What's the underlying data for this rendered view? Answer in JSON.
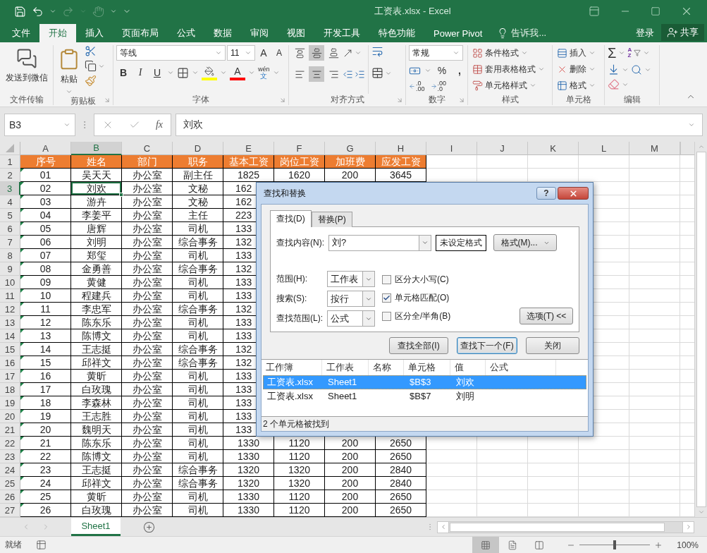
{
  "title_bar": {
    "title": "工资表.xlsx - Excel"
  },
  "menu_tabs": [
    {
      "label": "文件",
      "selected": false
    },
    {
      "label": "开始",
      "selected": true
    },
    {
      "label": "插入",
      "selected": false
    },
    {
      "label": "页面布局",
      "selected": false
    },
    {
      "label": "公式",
      "selected": false
    },
    {
      "label": "数据",
      "selected": false
    },
    {
      "label": "审阅",
      "selected": false
    },
    {
      "label": "视图",
      "selected": false
    },
    {
      "label": "开发工具",
      "selected": false
    },
    {
      "label": "特色功能",
      "selected": false
    },
    {
      "label": "Power Pivot",
      "selected": false
    }
  ],
  "tell_me": {
    "placeholder": "告诉我..."
  },
  "account": {
    "sign_in": "登录",
    "share": "共享"
  },
  "ribbon": {
    "file_transfer": {
      "button": "发送到微信",
      "label": "文件传输"
    },
    "clipboard": {
      "paste": "粘贴",
      "label": "剪贴板"
    },
    "font": {
      "font_name": "等线",
      "font_size": "11",
      "grow": "A",
      "shrink": "A",
      "bold": "B",
      "italic": "I",
      "underline": "U",
      "font_color": "A",
      "phonetic": [
        "wén",
        "文"
      ],
      "label": "字体"
    },
    "alignment": {
      "vertical": [
        {
          "selected": false
        },
        {
          "selected": true
        },
        {
          "selected": false
        }
      ],
      "horizontal": [
        {
          "selected": false
        },
        {
          "selected": true
        },
        {
          "selected": false
        }
      ],
      "label": "对齐方式"
    },
    "number": {
      "format": "常规",
      "percent": "%",
      "comma": ",",
      "decimals": [
        [
          ".0",
          ".00"
        ],
        [
          ".00",
          ".0"
        ]
      ],
      "label": "数字"
    },
    "styles": {
      "items": [
        "条件格式",
        "套用表格格式",
        "单元格样式"
      ],
      "label": "样式"
    },
    "cells": {
      "items": [
        "插入",
        "删除",
        "格式"
      ],
      "label": "单元格"
    },
    "editing": {
      "autosum": "Σ",
      "sort": [
        "A",
        "Z"
      ],
      "label": "编辑"
    }
  },
  "formula_bar": {
    "name_box": "B3",
    "function": "fx",
    "value": "刘欢"
  },
  "columns": [
    {
      "label": "A",
      "selected": false
    },
    {
      "label": "B",
      "selected": true
    },
    {
      "label": "C",
      "selected": false
    },
    {
      "label": "D",
      "selected": false
    },
    {
      "label": "E",
      "selected": false
    },
    {
      "label": "F",
      "selected": false
    },
    {
      "label": "G",
      "selected": false
    },
    {
      "label": "H",
      "selected": false
    },
    {
      "label": "I",
      "selected": false
    },
    {
      "label": "J",
      "selected": false
    },
    {
      "label": "K",
      "selected": false
    },
    {
      "label": "L",
      "selected": false
    },
    {
      "label": "M",
      "selected": false
    }
  ],
  "rows": [
    {
      "number": "1",
      "kind": "header",
      "selected": false,
      "warning": false,
      "cells": [
        "序号",
        "姓名",
        "部门",
        "职务",
        "基本工资",
        "岗位工资",
        "加班费",
        "应发工资"
      ]
    },
    {
      "number": "2",
      "kind": "data",
      "selected": false,
      "warning": true,
      "cells": [
        "01",
        "吴天天",
        "办公室",
        "副主任",
        "1825",
        "1620",
        "200",
        "3645"
      ]
    },
    {
      "number": "3",
      "kind": "data",
      "selected": true,
      "warning": true,
      "cells": [
        "02",
        "刘欢",
        "办公室",
        "文秘",
        "162"
      ]
    },
    {
      "number": "4",
      "kind": "data",
      "selected": false,
      "warning": true,
      "cells": [
        "03",
        "游卉",
        "办公室",
        "文秘",
        "162"
      ]
    },
    {
      "number": "5",
      "kind": "data",
      "selected": false,
      "warning": true,
      "cells": [
        "04",
        "李姜平",
        "办公室",
        "主任",
        "223"
      ]
    },
    {
      "number": "6",
      "kind": "data",
      "selected": false,
      "warning": true,
      "cells": [
        "05",
        "唐辉",
        "办公室",
        "司机",
        "133"
      ]
    },
    {
      "number": "7",
      "kind": "data",
      "selected": false,
      "warning": true,
      "cells": [
        "06",
        "刘明",
        "办公室",
        "综合事务",
        "132"
      ]
    },
    {
      "number": "8",
      "kind": "data",
      "selected": false,
      "warning": true,
      "cells": [
        "07",
        "郑玺",
        "办公室",
        "司机",
        "133"
      ]
    },
    {
      "number": "9",
      "kind": "data",
      "selected": false,
      "warning": true,
      "cells": [
        "08",
        "金勇善",
        "办公室",
        "综合事务",
        "132"
      ]
    },
    {
      "number": "10",
      "kind": "data",
      "selected": false,
      "warning": true,
      "cells": [
        "09",
        "黄健",
        "办公室",
        "司机",
        "133"
      ]
    },
    {
      "number": "11",
      "kind": "data",
      "selected": false,
      "warning": true,
      "cells": [
        "10",
        "程建兵",
        "办公室",
        "司机",
        "133"
      ]
    },
    {
      "number": "12",
      "kind": "data",
      "selected": false,
      "warning": true,
      "cells": [
        "11",
        "李忠军",
        "办公室",
        "综合事务",
        "132"
      ]
    },
    {
      "number": "13",
      "kind": "data",
      "selected": false,
      "warning": true,
      "cells": [
        "12",
        "陈东乐",
        "办公室",
        "司机",
        "133"
      ]
    },
    {
      "number": "14",
      "kind": "data",
      "selected": false,
      "warning": true,
      "cells": [
        "13",
        "陈博文",
        "办公室",
        "司机",
        "133"
      ]
    },
    {
      "number": "15",
      "kind": "data",
      "selected": false,
      "warning": true,
      "cells": [
        "14",
        "王志挺",
        "办公室",
        "综合事务",
        "132"
      ]
    },
    {
      "number": "16",
      "kind": "data",
      "selected": false,
      "warning": true,
      "cells": [
        "15",
        "邱祥文",
        "办公室",
        "综合事务",
        "132"
      ]
    },
    {
      "number": "17",
      "kind": "data",
      "selected": false,
      "warning": true,
      "cells": [
        "16",
        "黄昕",
        "办公室",
        "司机",
        "133"
      ]
    },
    {
      "number": "18",
      "kind": "data",
      "selected": false,
      "warning": true,
      "cells": [
        "17",
        "白玫瑰",
        "办公室",
        "司机",
        "133"
      ]
    },
    {
      "number": "19",
      "kind": "data",
      "selected": false,
      "warning": true,
      "cells": [
        "18",
        "李森林",
        "办公室",
        "司机",
        "133"
      ]
    },
    {
      "number": "20",
      "kind": "data",
      "selected": false,
      "warning": true,
      "cells": [
        "19",
        "王志胜",
        "办公室",
        "司机",
        "133"
      ]
    },
    {
      "number": "21",
      "kind": "data",
      "selected": false,
      "warning": true,
      "cells": [
        "20",
        "魏明天",
        "办公室",
        "司机",
        "133"
      ]
    },
    {
      "number": "22",
      "kind": "data",
      "selected": false,
      "warning": true,
      "cells": [
        "21",
        "陈东乐",
        "办公室",
        "司机",
        "1330",
        "1120",
        "200",
        "2650"
      ]
    },
    {
      "number": "23",
      "kind": "data",
      "selected": false,
      "warning": true,
      "cells": [
        "22",
        "陈博文",
        "办公室",
        "司机",
        "1330",
        "1120",
        "200",
        "2650"
      ]
    },
    {
      "number": "24",
      "kind": "data",
      "selected": false,
      "warning": true,
      "cells": [
        "23",
        "王志挺",
        "办公室",
        "综合事务",
        "1320",
        "1320",
        "200",
        "2840"
      ]
    },
    {
      "number": "25",
      "kind": "data",
      "selected": false,
      "warning": true,
      "cells": [
        "24",
        "邱祥文",
        "办公室",
        "综合事务",
        "1320",
        "1320",
        "200",
        "2840"
      ]
    },
    {
      "number": "26",
      "kind": "data",
      "selected": false,
      "warning": true,
      "cells": [
        "25",
        "黄昕",
        "办公室",
        "司机",
        "1330",
        "1120",
        "200",
        "2650"
      ]
    },
    {
      "number": "27",
      "kind": "data",
      "selected": false,
      "warning": true,
      "cells": [
        "26",
        "白玫瑰",
        "办公室",
        "司机",
        "1330",
        "1120",
        "200",
        "2650"
      ]
    }
  ],
  "sheet_tabs": [
    {
      "label": "Sheet1",
      "selected": true
    }
  ],
  "status_bar": {
    "status": "就绪",
    "views": [
      {
        "selected": true
      },
      {
        "selected": false
      },
      {
        "selected": false
      }
    ],
    "zoom": {
      "level": 0.5,
      "reading": "100%"
    }
  },
  "dialog": {
    "title": "查找和替换",
    "help": "?",
    "tabs": [
      {
        "label": "查找(D)",
        "selected": true
      },
      {
        "label": "替换(P)",
        "selected": false
      }
    ],
    "find_what": {
      "label": "查找内容(N):",
      "value": "刘?"
    },
    "format_preview": "未设定格式",
    "format_button": "格式(M)...",
    "selects": [
      {
        "label": "范围(H):",
        "value": "工作表"
      },
      {
        "label": "搜索(S):",
        "value": "按行"
      },
      {
        "label": "查找范围(L):",
        "value": "公式"
      }
    ],
    "checkboxes": [
      {
        "label": "区分大小写(C)",
        "checked": false
      },
      {
        "label": "单元格匹配(O)",
        "checked": true
      },
      {
        "label": "区分全/半角(B)",
        "checked": false
      }
    ],
    "options_button": "选项(T)  <<",
    "buttons": [
      {
        "label": "查找全部(I)",
        "focused": false
      },
      {
        "label": "查找下一个(F)",
        "focused": true
      },
      {
        "label": "关闭",
        "focused": false
      }
    ],
    "result_columns": [
      "工作簿",
      "工作表",
      "名称",
      "单元格",
      "值",
      "公式"
    ],
    "results": [
      {
        "workbook": "工资表.xlsx",
        "sheet": "Sheet1",
        "cell": "$B$3",
        "value": "刘欢",
        "selected": true
      },
      {
        "workbook": "工资表.xlsx",
        "sheet": "Sheet1",
        "cell": "$B$7",
        "value": "刘明",
        "selected": false
      }
    ],
    "status": "2 个单元格被找到"
  }
}
